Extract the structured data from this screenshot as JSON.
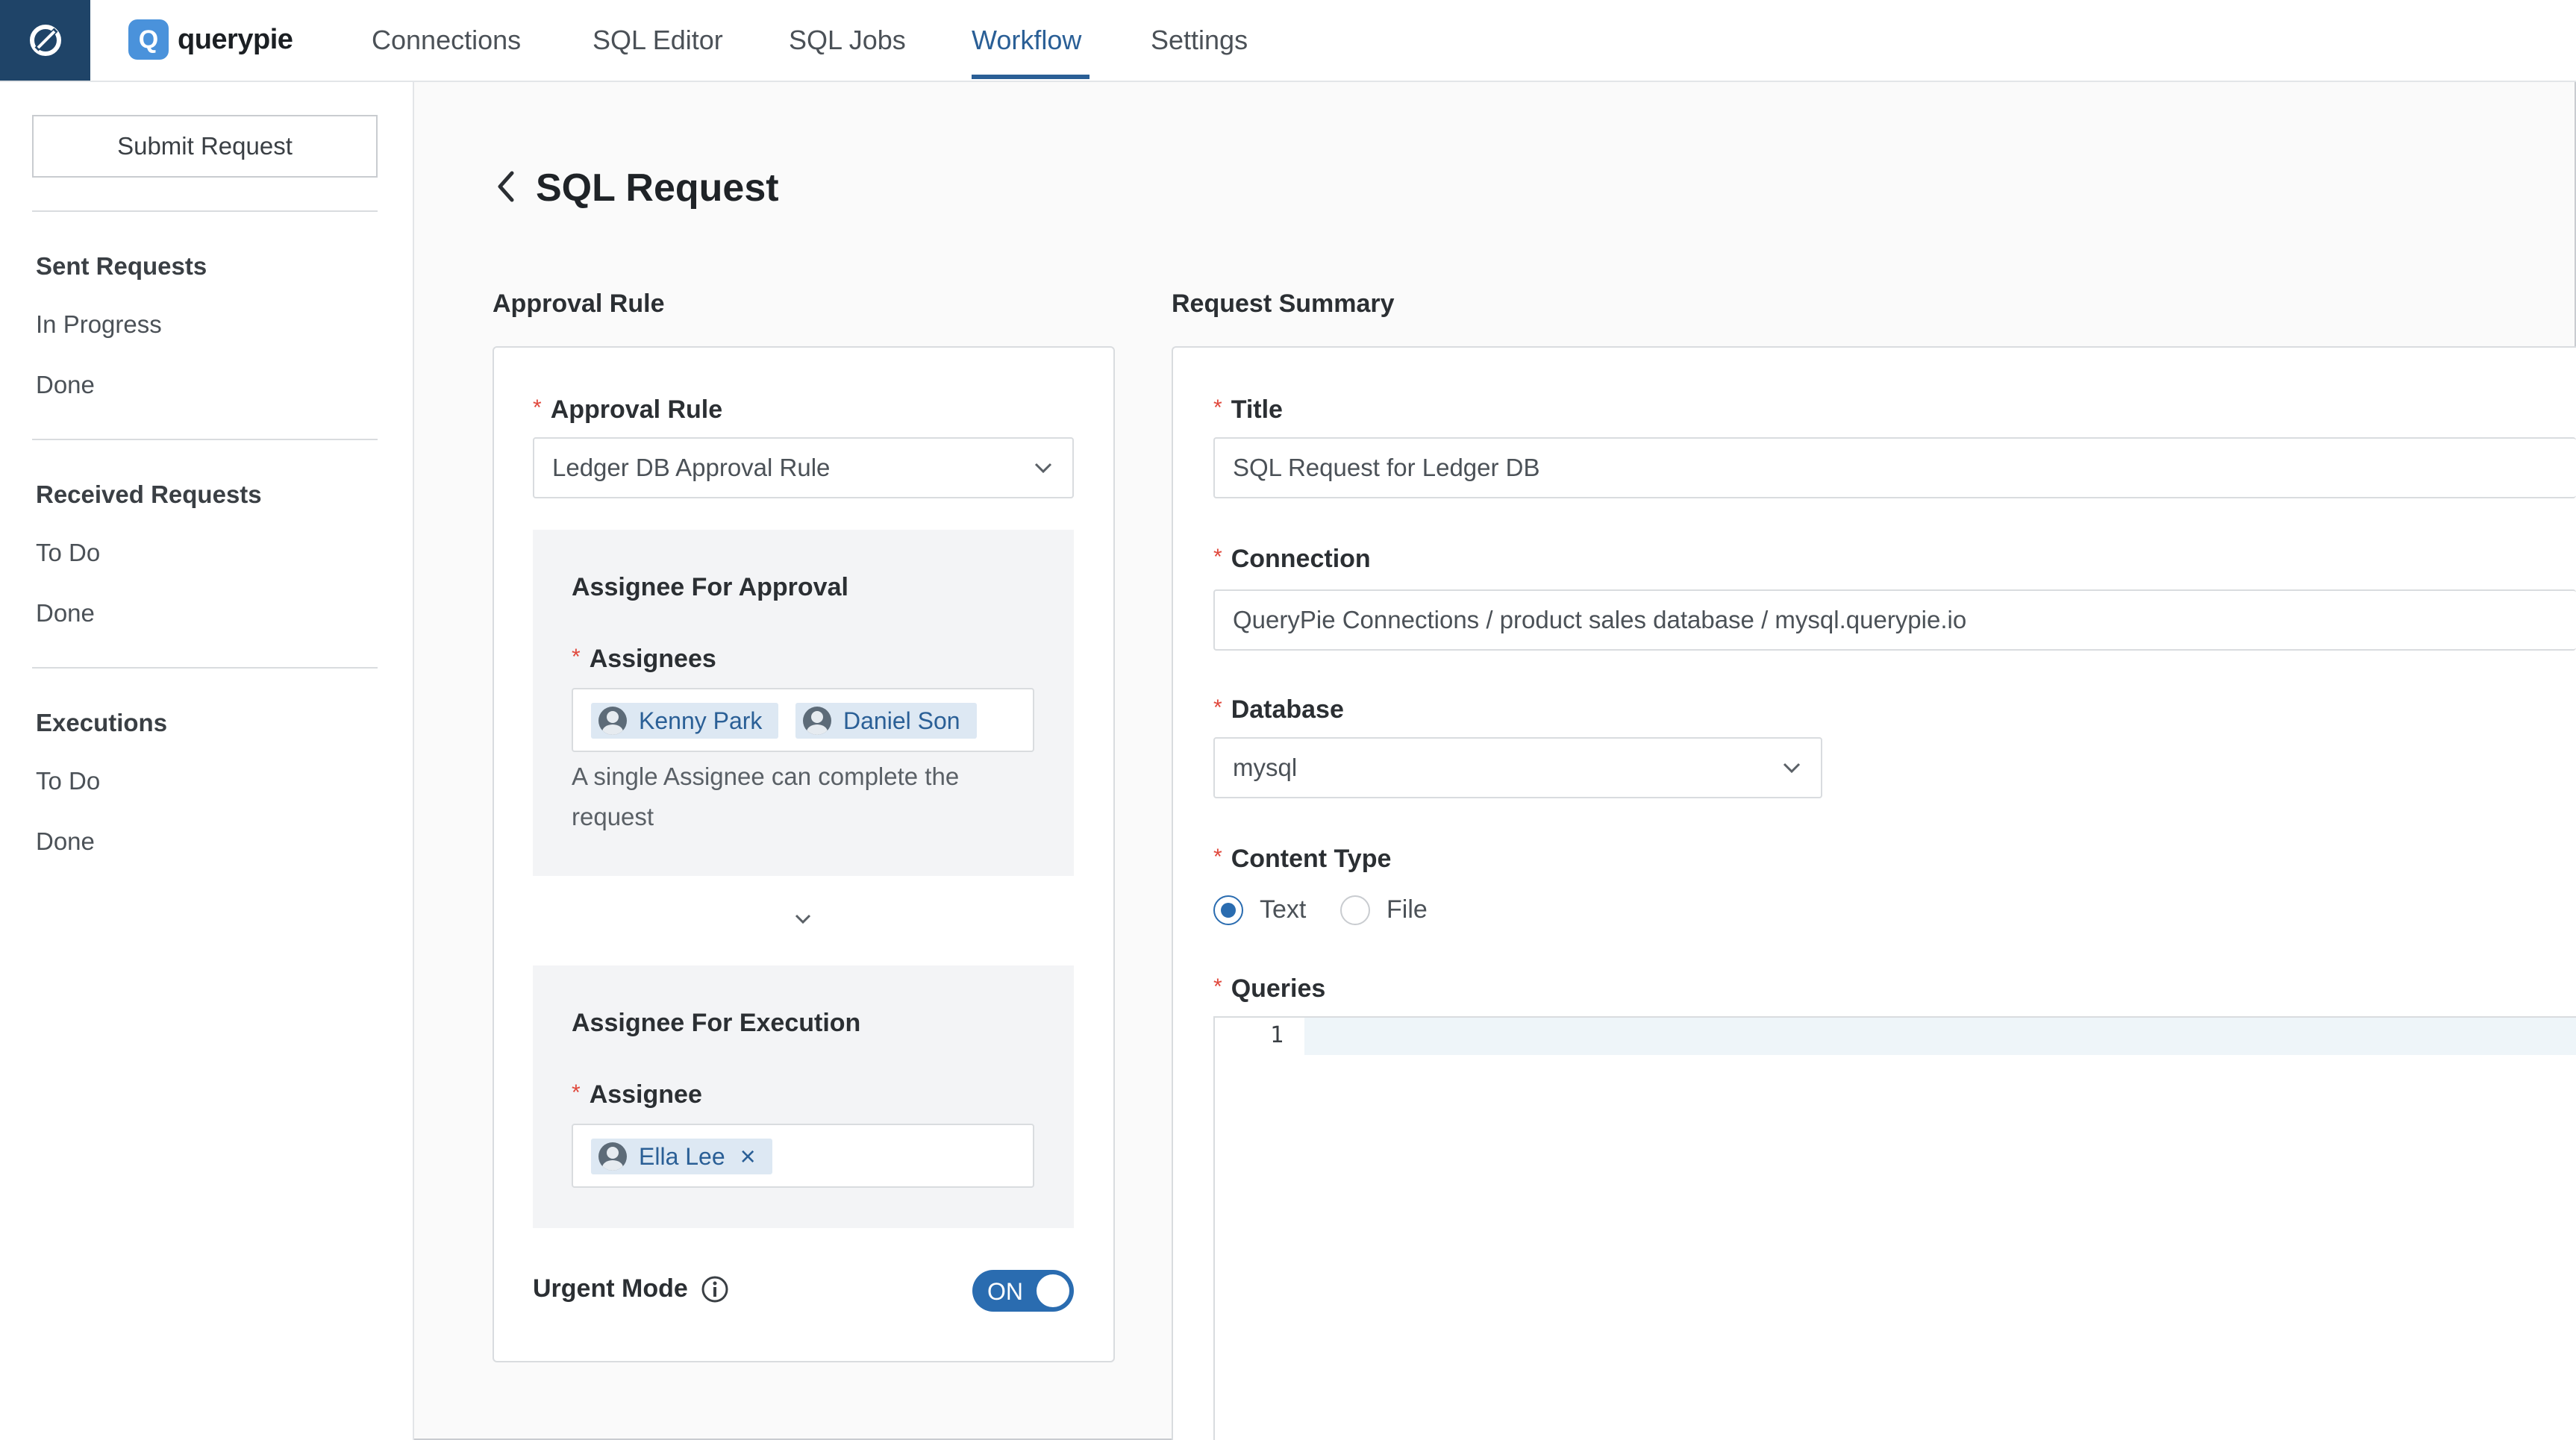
{
  "app": {
    "name": "querypie",
    "logo_letter": "Q"
  },
  "nav": {
    "items": [
      {
        "label": "Connections"
      },
      {
        "label": "SQL Editor"
      },
      {
        "label": "SQL Jobs"
      },
      {
        "label": "Workflow",
        "active": true
      },
      {
        "label": "Settings"
      }
    ]
  },
  "sidebar": {
    "submit_label": "Submit Request",
    "sent": {
      "heading": "Sent Requests",
      "items": [
        "In Progress",
        "Done"
      ]
    },
    "received": {
      "heading": "Received Requests",
      "items": [
        "To Do",
        "Done"
      ]
    },
    "executions": {
      "heading": "Executions",
      "items": [
        "To Do",
        "Done"
      ]
    }
  },
  "page": {
    "title": "SQL Request"
  },
  "approval": {
    "section_label": "Approval Rule",
    "rule_label": "Approval Rule",
    "rule_value": "Ledger DB Approval Rule",
    "approval_panel": {
      "title": "Assignee For Approval",
      "assignees_label": "Assignees",
      "assignees": [
        "Kenny Park",
        "Daniel Son"
      ],
      "help_line1": "A single Assignee can complete the",
      "help_line2": "request"
    },
    "execution_panel": {
      "title": "Assignee For Execution",
      "assignee_label": "Assignee",
      "assignee": "Ella Lee",
      "remove_glyph": "×"
    },
    "urgent_label": "Urgent Mode",
    "urgent_state": "ON"
  },
  "summary": {
    "section_label": "Request Summary",
    "title_label": "Title",
    "title_value": "SQL Request for Ledger DB",
    "connection_label": "Connection",
    "connection_value": "QueryPie Connections / product sales database / mysql.querypie.io",
    "database_label": "Database",
    "database_value": "mysql",
    "content_type_label": "Content Type",
    "content_type_options": [
      "Text",
      "File"
    ],
    "content_type_selected": "Text",
    "queries_label": "Queries",
    "line_number": "1"
  },
  "colors": {
    "accent": "#2a6cb0",
    "brand_dark": "#1f4468",
    "required": "#e0483c"
  }
}
